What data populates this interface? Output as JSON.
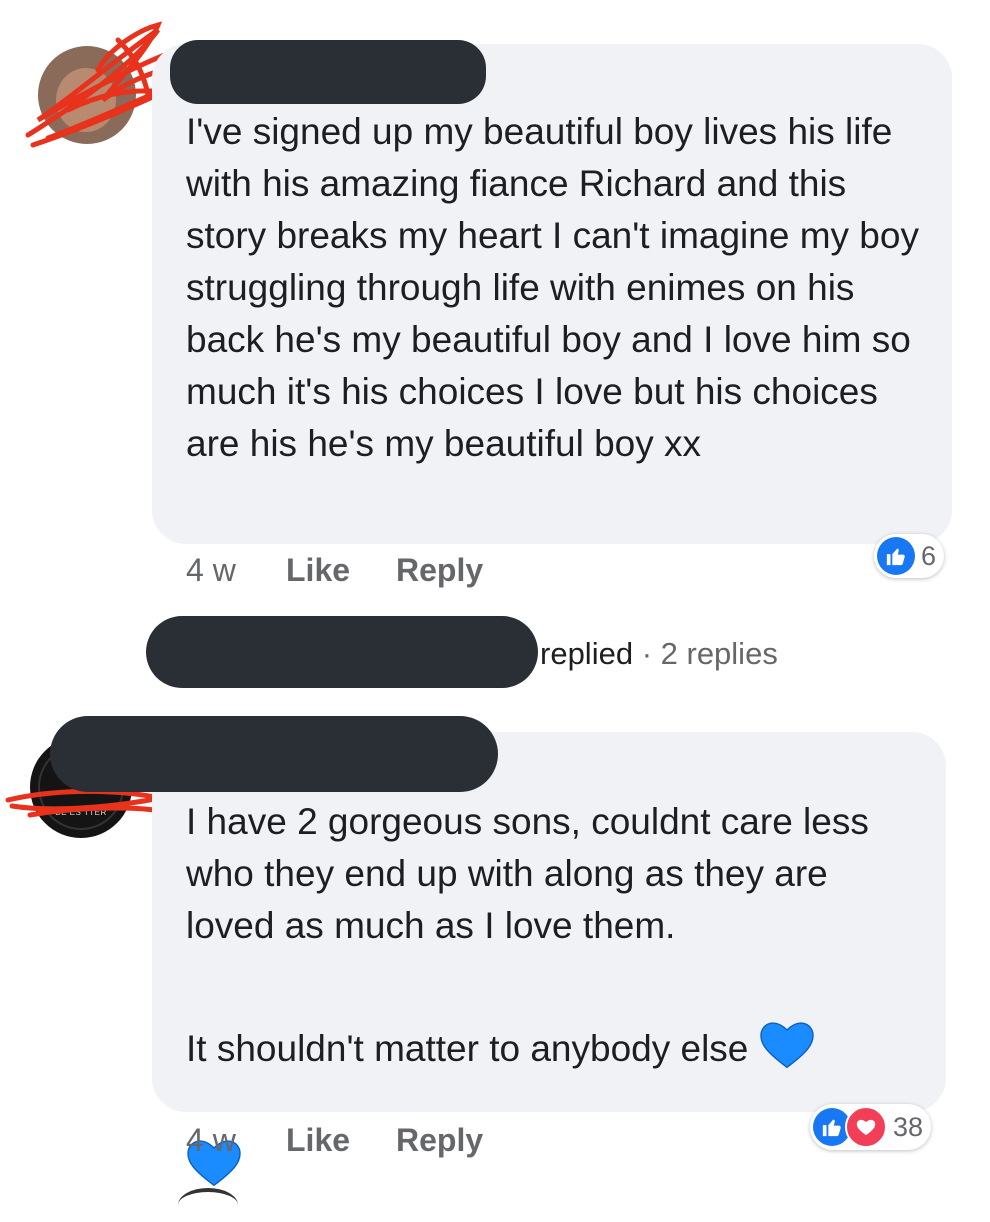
{
  "comments": [
    {
      "text": "I've signed up my beautiful boy lives his life with his amazing fiance Richard and this story breaks my heart I can't imagine my boy struggling through life with enimes  on his back he's my beautiful boy and I love him so much it's his choices I love but his choices are his he's my beautiful boy xx",
      "time": "4 w",
      "like_label": "Like",
      "reply_label": "Reply",
      "reaction_count": "6",
      "reactions": [
        "like-icon"
      ]
    },
    {
      "text_line1": "I have 2 gorgeous sons, couldnt care less who they end up with along as they are loved as much as I love them.",
      "text_line2": "It shouldn't matter to anybody else ",
      "time": "4 w",
      "like_label": "Like",
      "reply_label": "Reply",
      "reaction_count": "38",
      "reactions": [
        "like-icon",
        "love-icon"
      ],
      "avatar_text": "BE    ES    TTER"
    }
  ],
  "reply_thread": {
    "replied_label": "replied",
    "separator": "·",
    "replies_count": "2 replies"
  },
  "colors": {
    "bubble": "#f0f2f5",
    "redaction": "#2a2f35",
    "scribble": "#e8321c",
    "like_blue": "#1877f2",
    "love_red": "#f33e58",
    "heart_blue": "#1a8cff"
  }
}
